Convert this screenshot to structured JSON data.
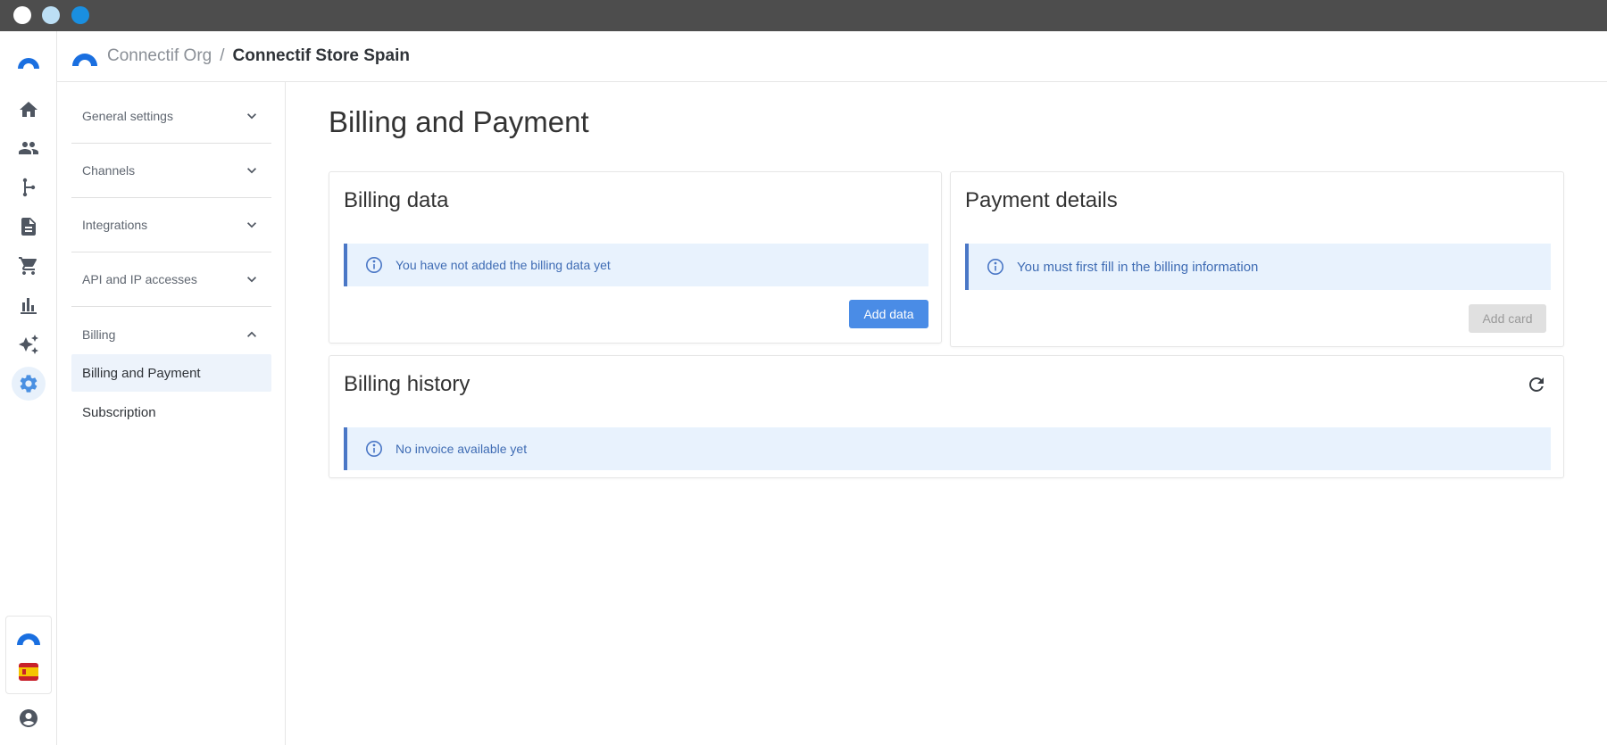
{
  "breadcrumb": {
    "org": "Connectif Org",
    "separator": "/",
    "store": "Connectif Store Spain"
  },
  "rail": {
    "items": [
      "home-icon",
      "contacts-icon",
      "workflows-icon",
      "contents-icon",
      "cart-icon",
      "reports-icon",
      "ai-icon",
      "settings-icon"
    ],
    "active": "settings-icon",
    "bottom": [
      "connectif-logo",
      "spain-flag-icon",
      "account-icon"
    ]
  },
  "subnav": {
    "groups": [
      {
        "label": "General settings",
        "expanded": false
      },
      {
        "label": "Channels",
        "expanded": false
      },
      {
        "label": "Integrations",
        "expanded": false
      },
      {
        "label": "API and IP accesses",
        "expanded": false
      },
      {
        "label": "Billing",
        "expanded": true
      }
    ],
    "billing_items": [
      {
        "label": "Billing and Payment",
        "active": true
      },
      {
        "label": "Subscription",
        "active": false
      }
    ]
  },
  "page": {
    "title": "Billing and Payment"
  },
  "billing_data": {
    "title": "Billing data",
    "notice": "You have not added the billing data yet",
    "button": "Add data"
  },
  "payment_details": {
    "title": "Payment details",
    "notice": "You must first fill in the billing information",
    "button": "Add card"
  },
  "billing_history": {
    "title": "Billing history",
    "notice": "No invoice available yet"
  },
  "colors": {
    "accent": "#4a8ce6",
    "info_bg": "#e8f2fd",
    "info_border": "#4a77c6"
  }
}
